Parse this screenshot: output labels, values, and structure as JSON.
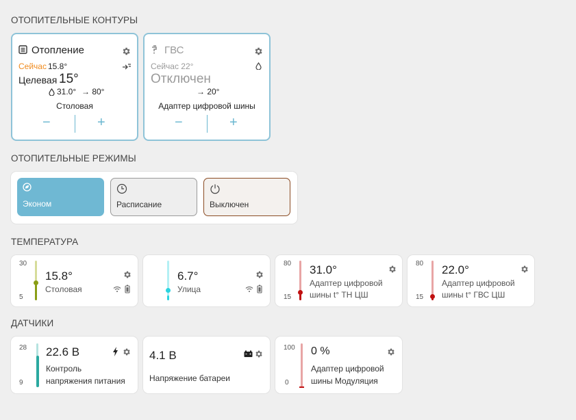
{
  "sections": {
    "circuits": "ОТОПИТЕЛЬНЫЕ КОНТУРЫ",
    "modes": "ОТОПИТЕЛЬНЫЕ РЕЖИМЫ",
    "temperature": "ТЕМПЕРАТУРА",
    "sensors": "ДАТЧИКИ"
  },
  "circuits": [
    {
      "title": "Отопление",
      "now_label": "Сейчас",
      "now_value": "15.8°",
      "target_label": "Целевая",
      "target_value": "15°",
      "param1": "31.0°",
      "param2": "→ 80°",
      "sensor": "Столовая",
      "minus": "−",
      "plus": "+"
    },
    {
      "title": "ГВС",
      "now_text": "Сейчас 22°",
      "status": "Отключен",
      "param": "→ 20°",
      "sensor": "Адаптер цифровой шины",
      "minus": "−",
      "plus": "+"
    }
  ],
  "modes": [
    {
      "label": "Эконом",
      "active": true
    },
    {
      "label": "Расписание",
      "active": false
    },
    {
      "label": "Выключен",
      "active": false
    }
  ],
  "temperature": [
    {
      "max": "30",
      "min": "5",
      "value": "15.8°",
      "name": "Столовая",
      "level": 0.43,
      "color": "#8a9e16"
    },
    {
      "value": "6.7°",
      "name": "Улица",
      "level": 0.07,
      "color": "#2bd4e0"
    },
    {
      "max": "80",
      "min": "15",
      "value": "31.0°",
      "name1": "Адаптер цифровой",
      "name2": "шины t° ТН ЦШ",
      "level": 0.25,
      "color": "#c01010"
    },
    {
      "max": "80",
      "min": "15",
      "value": "22.0°",
      "name1": "Адаптер цифровой",
      "name2": "шины t° ГВС ЦШ",
      "level": 0.11,
      "color": "#c01010"
    }
  ],
  "sensors": [
    {
      "max": "28",
      "min": "9",
      "value": "22.6 В",
      "name1": "Контроль",
      "name2": "напряжения питания",
      "level": 0.72,
      "color": "#2aa9a0"
    },
    {
      "value": "4.1 В",
      "name": "Напряжение батареи"
    },
    {
      "max": "100",
      "min": "0",
      "value": "0 %",
      "name1": "Адаптер цифровой",
      "name2": "шины Модуляция",
      "level": 0.0,
      "color": "#c01010"
    }
  ],
  "colors": {
    "accent": "#6ab7d0",
    "orange": "#f08a1c",
    "border": "#8ec3d8"
  }
}
